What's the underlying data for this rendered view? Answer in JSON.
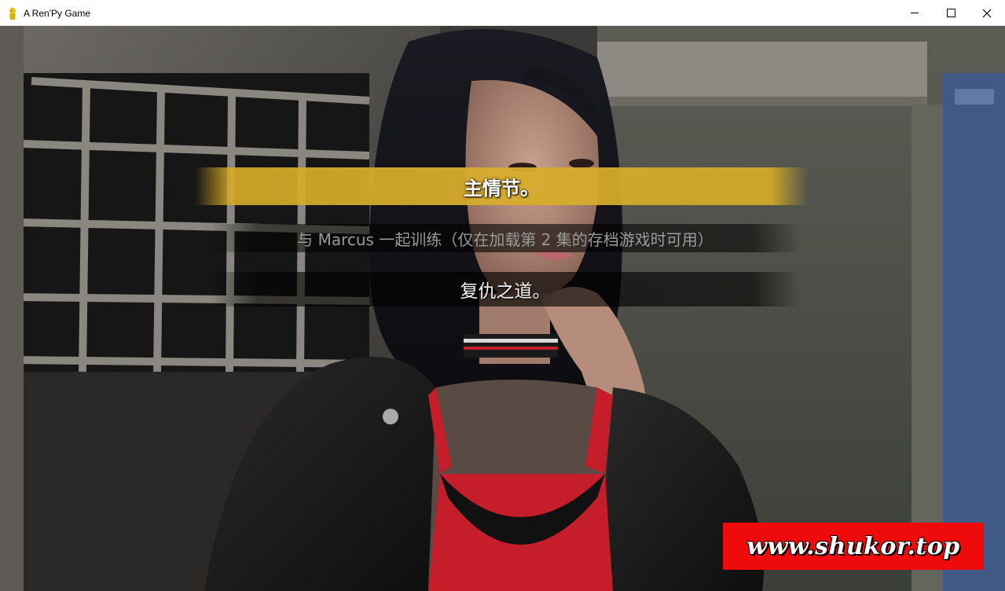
{
  "window": {
    "title": "A Ren'Py Game",
    "controls": {
      "minimize_icon": "minimize-icon",
      "maximize_icon": "maximize-icon",
      "close_icon": "close-icon"
    }
  },
  "scene": {
    "background": "alley-wall-with-barred-window",
    "character": "dark-haired-woman-in-leather-jacket"
  },
  "menu": {
    "choices": [
      {
        "label": "主情节。",
        "state": "hover"
      },
      {
        "label": "与 Marcus 一起训练（仅在加载第 2 集的存档游戏时可用）",
        "state": "disabled"
      },
      {
        "label": "复仇之道。",
        "state": "idle"
      }
    ]
  },
  "watermark": {
    "text": "www.shukor.top"
  },
  "colors": {
    "selected_choice_bg": "#d4aa28",
    "disabled_text": "#9a9a9a",
    "watermark_bg": "#ef0b0b"
  }
}
